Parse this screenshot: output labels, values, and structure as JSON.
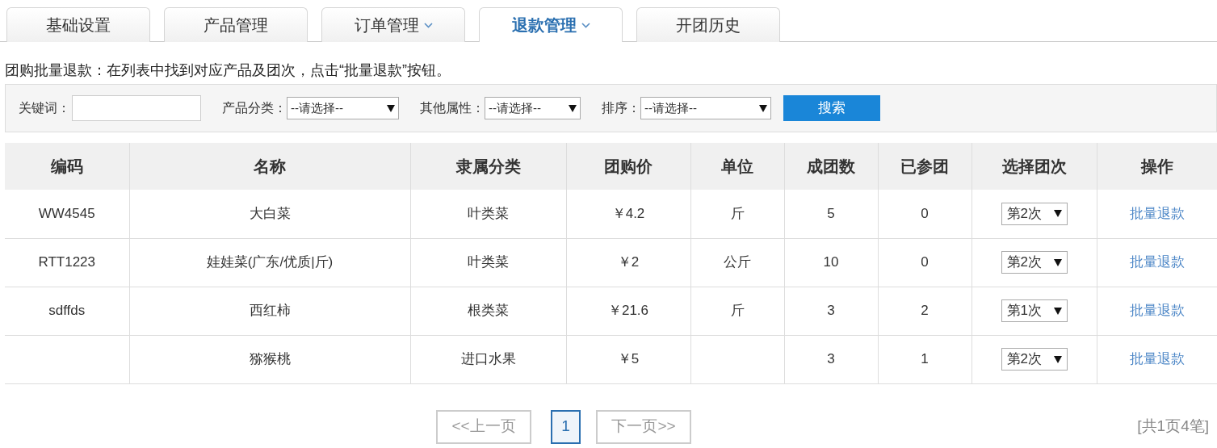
{
  "tabs": [
    {
      "label": "基础设置",
      "selected": false,
      "dropdown": false
    },
    {
      "label": "产品管理",
      "selected": false,
      "dropdown": false
    },
    {
      "label": "订单管理",
      "selected": false,
      "dropdown": true
    },
    {
      "label": "退款管理",
      "selected": true,
      "dropdown": true
    },
    {
      "label": "开团历史",
      "selected": false,
      "dropdown": false
    }
  ],
  "instruction": "团购批量退款：在列表中找到对应产品及团次，点击“批量退款”按钮。",
  "filters": {
    "keyword": {
      "label": "关键词："
    },
    "selects": [
      {
        "label": "产品分类：",
        "value": "--请选择--"
      },
      {
        "label": "其他属性：",
        "value": "--请选择--"
      },
      {
        "label": "排序：",
        "value": "--请选择--"
      }
    ],
    "search_button": "搜索"
  },
  "table": {
    "columns": [
      "编码",
      "名称",
      "隶属分类",
      "团购价",
      "单位",
      "成团数",
      "已参团",
      "选择团次",
      "操作"
    ],
    "rows": [
      {
        "code": "WW4545",
        "name": "大白菜",
        "category": "叶类菜",
        "price": "￥4.2",
        "unit": "斤",
        "groups": "5",
        "joined": "0",
        "round": "第2次",
        "action": "批量退款"
      },
      {
        "code": "RTT1223",
        "name": "娃娃菜(广东/优质|斤)",
        "category": "叶类菜",
        "price": "￥2",
        "unit": "公斤",
        "groups": "10",
        "joined": "0",
        "round": "第2次",
        "action": "批量退款"
      },
      {
        "code": "sdffds",
        "name": "西红柿",
        "category": "根类菜",
        "price": "￥21.6",
        "unit": "斤",
        "groups": "3",
        "joined": "2",
        "round": "第1次",
        "action": "批量退款"
      },
      {
        "name": "猕猴桃",
        "category": "进口水果",
        "price": "￥5",
        "groups": "3",
        "joined": "1",
        "round": "第2次",
        "action": "批量退款"
      }
    ]
  },
  "pagination": {
    "prev": {
      "label": "<<上一页",
      "disabled": true
    },
    "pages": [
      {
        "label": "1",
        "selected": true
      }
    ],
    "next": {
      "label": "下一页>>",
      "disabled": true
    },
    "summary": "[共1页4笔]"
  }
}
